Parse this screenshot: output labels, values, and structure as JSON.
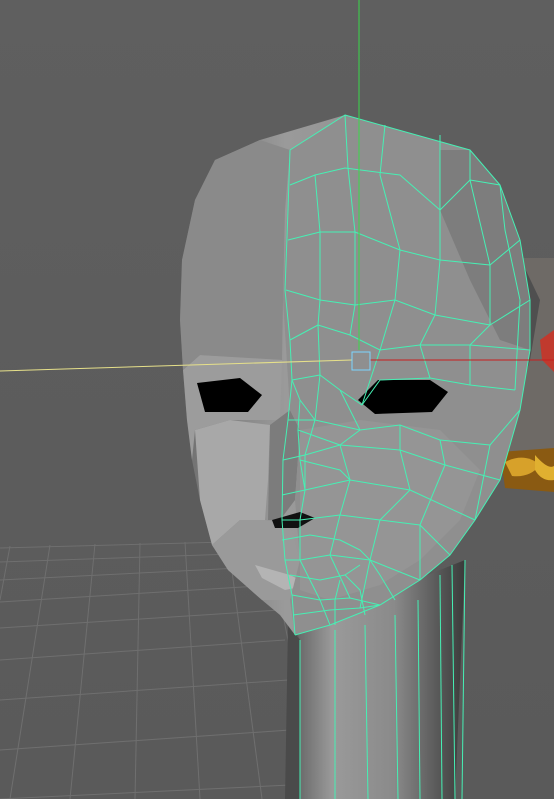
{
  "viewport": {
    "name": "perspective-viewport",
    "background_color": "#5e5e5e",
    "grid_color": "#6f6f6f",
    "mesh": {
      "object": "head-mesh",
      "mirrored_half_wireframe_color": "#46f0b4",
      "surface_color": "#8c8c8c",
      "eye_hole_color": "#000000"
    },
    "manipulator": {
      "y_axis_color": "#38d84a",
      "x_axis_color": "#c81e1e",
      "z_axis_color": "#e6e08a",
      "pivot_color": "#7bd6ff"
    },
    "reference_image_icon": "reference-image-thumbnail"
  }
}
